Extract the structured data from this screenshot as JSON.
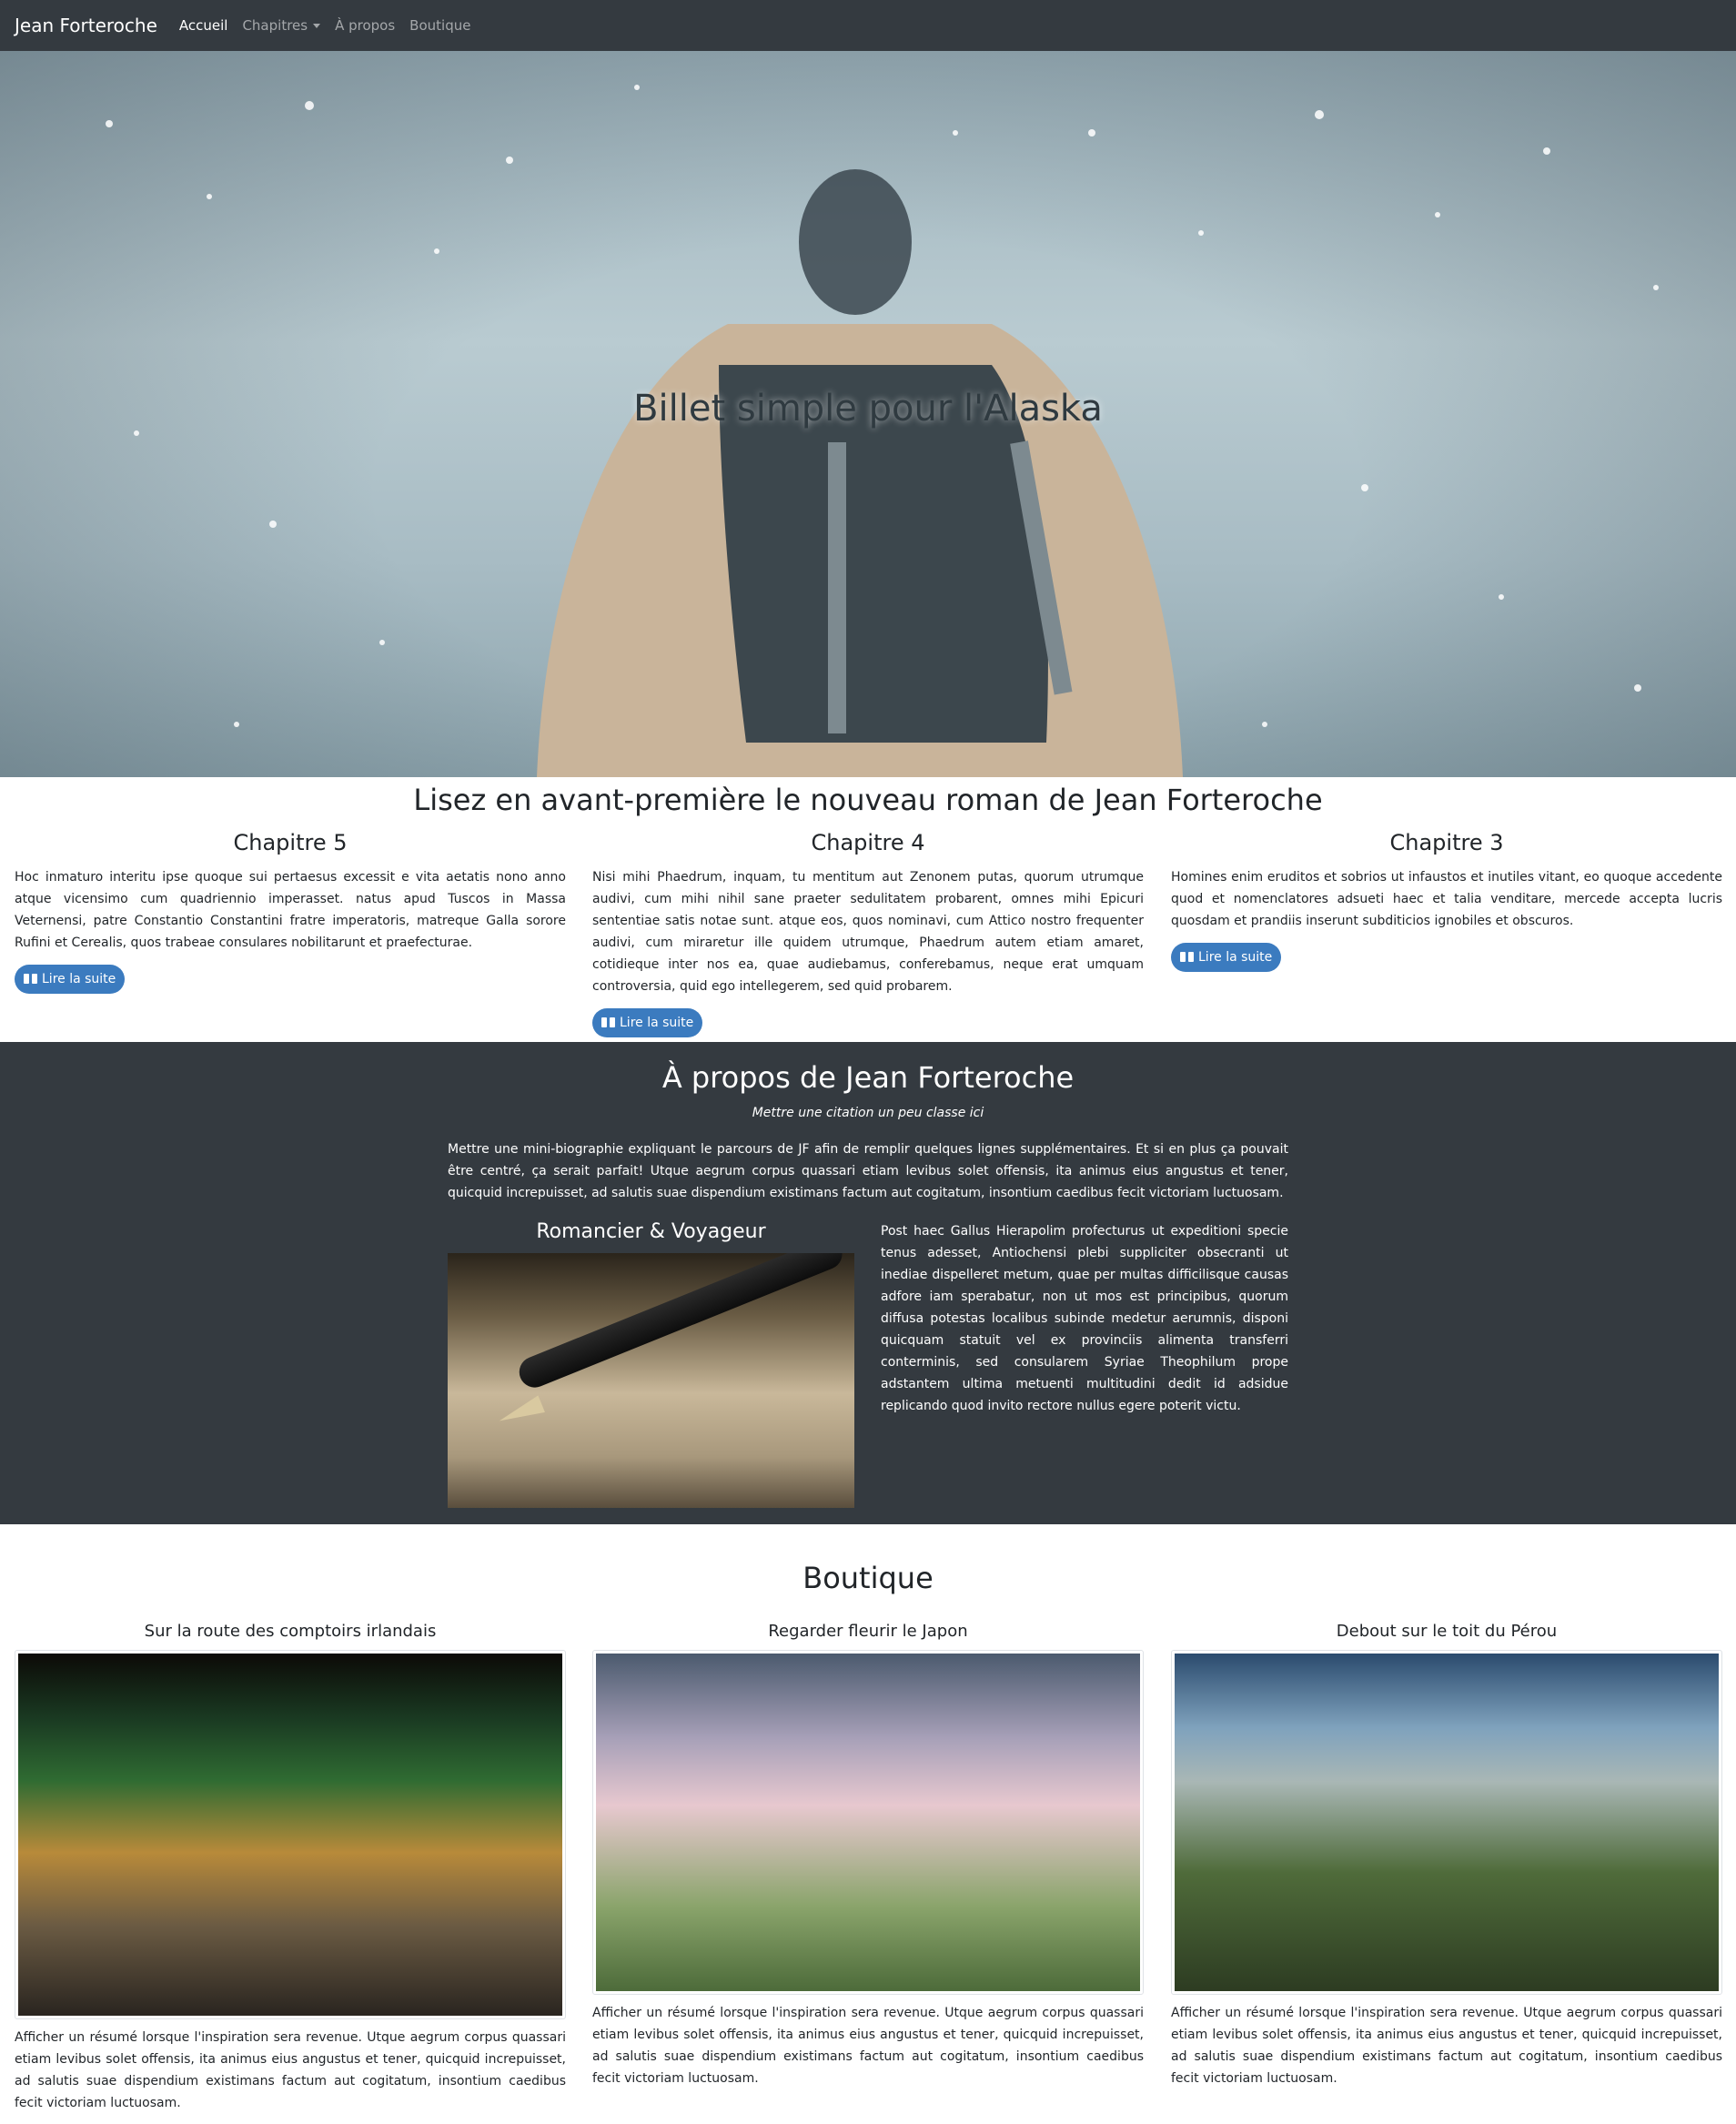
{
  "navbar": {
    "brand": "Jean Forteroche",
    "items": [
      {
        "label": "Accueil",
        "active": true
      },
      {
        "label": "Chapitres",
        "dropdown": true
      },
      {
        "label": "À propos"
      },
      {
        "label": "Boutique"
      }
    ]
  },
  "hero": {
    "title": "Billet simple pour l'Alaska"
  },
  "chapters": {
    "heading": "Lisez en avant-première le nouveau roman de Jean Forteroche",
    "button_label": "Lire la suite",
    "items": [
      {
        "title": "Chapitre 5",
        "text": "Hoc inmaturo interitu ipse quoque sui pertaesus excessit e vita aetatis nono anno atque vicensimo cum quadriennio imperasset. natus apud Tuscos in Massa Veternensi, patre Constantio Constantini fratre imperatoris, matreque Galla sorore Rufini et Cerealis, quos trabeae consulares nobilitarunt et praefecturae."
      },
      {
        "title": "Chapitre 4",
        "text": "Nisi mihi Phaedrum, inquam, tu mentitum aut Zenonem putas, quorum utrumque audivi, cum mihi nihil sane praeter sedulitatem probarent, omnes mihi Epicuri sententiae satis notae sunt. atque eos, quos nominavi, cum Attico nostro frequenter audivi, cum miraretur ille quidem utrumque, Phaedrum autem etiam amaret, cotidieque inter nos ea, quae audiebamus, conferebamus, neque erat umquam controversia, quid ego intellegerem, sed quid probarem."
      },
      {
        "title": "Chapitre 3",
        "text": "Homines enim eruditos et sobrios ut infaustos et inutiles vitant, eo quoque accedente quod et nomenclatores adsueti haec et talia venditare, mercede accepta lucris quosdam et prandiis inserunt subditicios ignobiles et obscuros."
      }
    ]
  },
  "about": {
    "heading": "À propos de Jean Forteroche",
    "quote": "Mettre une citation un peu classe ici",
    "bio": "Mettre une mini-biographie expliquant le parcours de JF afin de remplir quelques lignes supplémentaires. Et si en plus ça pouvait être centré, ça serait parfait! Utque aegrum corpus quassari etiam levibus solet offensis, ita animus eius angustus et tener, quicquid increpuisset, ad salutis suae dispendium existimans factum aut cogitatum, insontium caedibus fecit victoriam luctuosam.",
    "role": "Romancier & Voyageur",
    "side_text": "Post haec Gallus Hierapolim profecturus ut expeditioni specie tenus adesset, Antiochensi plebi suppliciter obsecranti ut inediae dispelleret metum, quae per multas difficilisque causas adfore iam sperabatur, non ut mos est principibus, quorum diffusa potestas localibus subinde medetur aerumnis, disponi quicquam statuit vel ex provinciis alimenta transferri conterminis, sed consularem Syriae Theophilum prope adstantem ultima metuenti multitudini dedit id adsidue replicando quod invito rectore nullus egere poterit victu."
  },
  "shop": {
    "heading": "Boutique",
    "items": [
      {
        "title": "Sur la route des comptoirs irlandais",
        "text": "Afficher un résumé lorsque l'inspiration sera revenue. Utque aegrum corpus quassari etiam levibus solet offensis, ita animus eius angustus et tener, quicquid increpuisset, ad salutis suae dispendium existimans factum aut cogitatum, insontium caedibus fecit victoriam luctuosam."
      },
      {
        "title": "Regarder fleurir le Japon",
        "text": "Afficher un résumé lorsque l'inspiration sera revenue. Utque aegrum corpus quassari etiam levibus solet offensis, ita animus eius angustus et tener, quicquid increpuisset, ad salutis suae dispendium existimans factum aut cogitatum, insontium caedibus fecit victoriam luctuosam."
      },
      {
        "title": "Debout sur le toit du Pérou",
        "text": "Afficher un résumé lorsque l'inspiration sera revenue. Utque aegrum corpus quassari etiam levibus solet offensis, ita animus eius angustus et tener, quicquid increpuisset, ad salutis suae dispendium existimans factum aut cogitatum, insontium caedibus fecit victoriam luctuosam."
      }
    ]
  },
  "colors": {
    "navbar_bg": "#343a40",
    "about_bg": "#343a40",
    "button_bg": "#3b7bbf"
  },
  "icons": [
    "book-icon",
    "chevron-down-icon"
  ]
}
